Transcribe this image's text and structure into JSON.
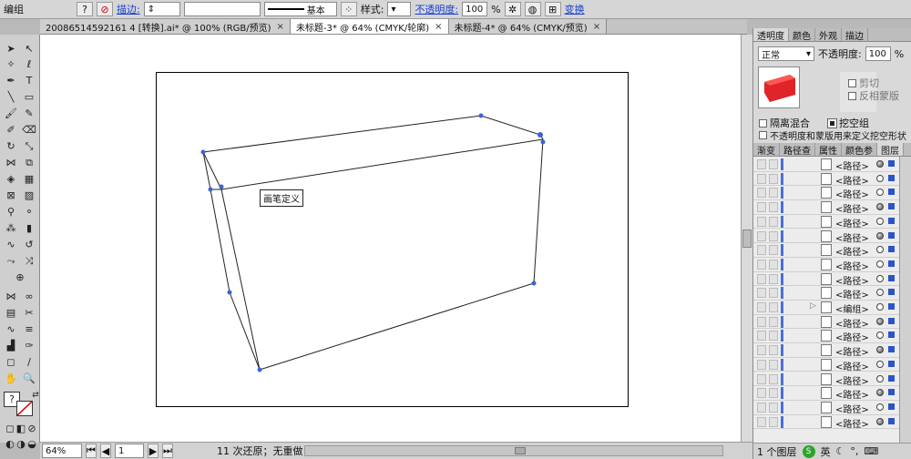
{
  "control_bar": {
    "selection_label": "编组",
    "stroke_label": "描边:",
    "stroke_style_label": "基本",
    "style_label": "样式:",
    "opacity_label": "不透明度:",
    "opacity_value": "100",
    "opacity_unit": "%",
    "transform_label": "变换"
  },
  "tabs": [
    {
      "label": "20086514592161 4 [转换].ai* @ 100% (RGB/预览)",
      "active": false
    },
    {
      "label": "未标题-3* @ 64% (CMYK/轮廓)",
      "active": true
    },
    {
      "label": "未标题-4* @ 64% (CMYK/预览)",
      "active": false
    }
  ],
  "canvas": {
    "tooltip": "画笔定义"
  },
  "status": {
    "zoom": "64%",
    "page": "1",
    "history": "11 次还原；无重做"
  },
  "panel": {
    "tabs": [
      "透明度",
      "颜色",
      "外观",
      "描边"
    ],
    "blend_mode": "正常",
    "opacity_label": "不透明度:",
    "opacity_value": "100",
    "opacity_unit": "%",
    "clip_label": "剪切",
    "invert_mask_label": "反相蒙版",
    "isolate_label": "隔离混合",
    "knockout_label": "挖空组",
    "mask_define_label": "不透明度和蒙版用来定义挖空形状",
    "lower_tabs": [
      "渐变",
      "路径查",
      "属性",
      "颜色参",
      "图层"
    ],
    "layers": [
      {
        "name": "<路径>",
        "filled": true
      },
      {
        "name": "<路径>",
        "filled": false
      },
      {
        "name": "<路径>",
        "filled": false
      },
      {
        "name": "<路径>",
        "filled": true
      },
      {
        "name": "<路径>",
        "filled": false
      },
      {
        "name": "<路径>",
        "filled": true
      },
      {
        "name": "<路径>",
        "filled": false
      },
      {
        "name": "<路径>",
        "filled": false
      },
      {
        "name": "<路径>",
        "filled": false
      },
      {
        "name": "<路径>",
        "filled": false
      },
      {
        "name": "<编组>",
        "filled": false
      },
      {
        "name": "<路径>",
        "filled": true
      },
      {
        "name": "<路径>",
        "filled": false
      },
      {
        "name": "<路径>",
        "filled": true
      },
      {
        "name": "<路径>",
        "filled": false
      },
      {
        "name": "<路径>",
        "filled": false
      },
      {
        "name": "<路径>",
        "filled": true
      },
      {
        "name": "<路径>",
        "filled": false
      },
      {
        "name": "<路径>",
        "filled": true
      }
    ],
    "footer_label": "1 个图层",
    "ime_label": "英"
  }
}
